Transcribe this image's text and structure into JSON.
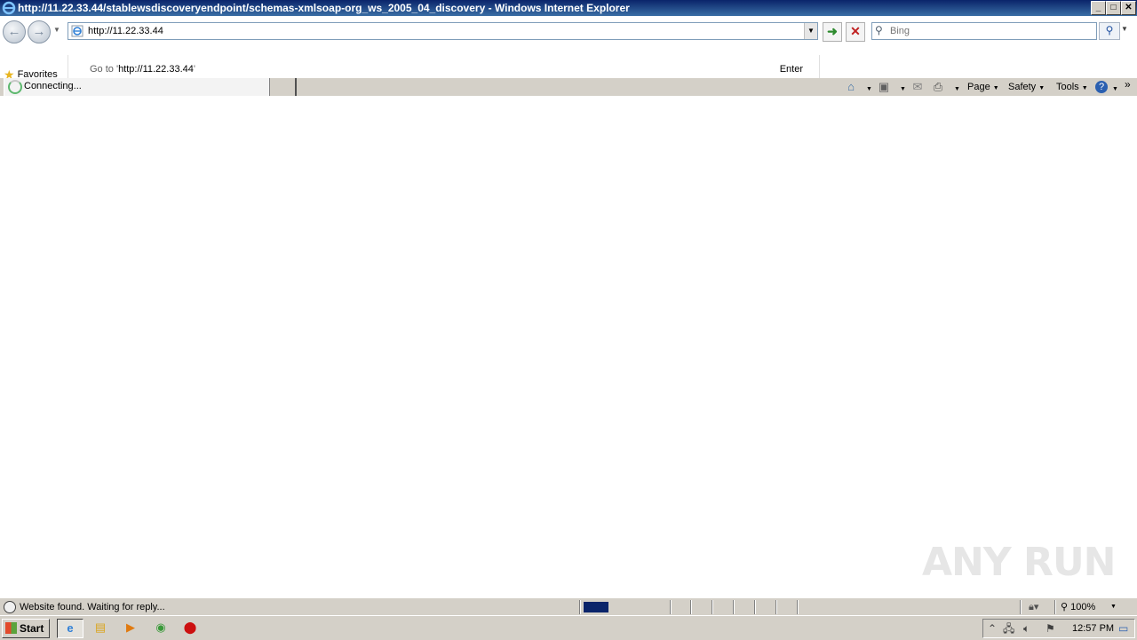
{
  "window": {
    "title": "http://11.22.33.44/stablewsdiscoveryendpoint/schemas-xmlsoap-org_ws_2005_04_discovery - Windows Internet Explorer",
    "minimize": "_",
    "maximize": "□",
    "close": "✕"
  },
  "nav": {
    "back": "←",
    "forward": "→",
    "address_value": "http://11.22.33.44",
    "search_placeholder": "Bing"
  },
  "favorites": {
    "label": "Favorites"
  },
  "autocomplete": {
    "goto_prefix": "Go to '",
    "goto_url": "http://11.22.33.44",
    "goto_suffix": "'",
    "enter_label": "Enter"
  },
  "tab": {
    "label": "Connecting..."
  },
  "commandbar": {
    "page": "Page",
    "safety": "Safety",
    "tools": "Tools"
  },
  "status": {
    "text": "Website found. Waiting for reply...",
    "progress_fraction": 0.3,
    "zoom": "100%"
  },
  "taskbar": {
    "start_label": "Start",
    "clock": "12:57 PM"
  },
  "watermark": "ANY RUN"
}
